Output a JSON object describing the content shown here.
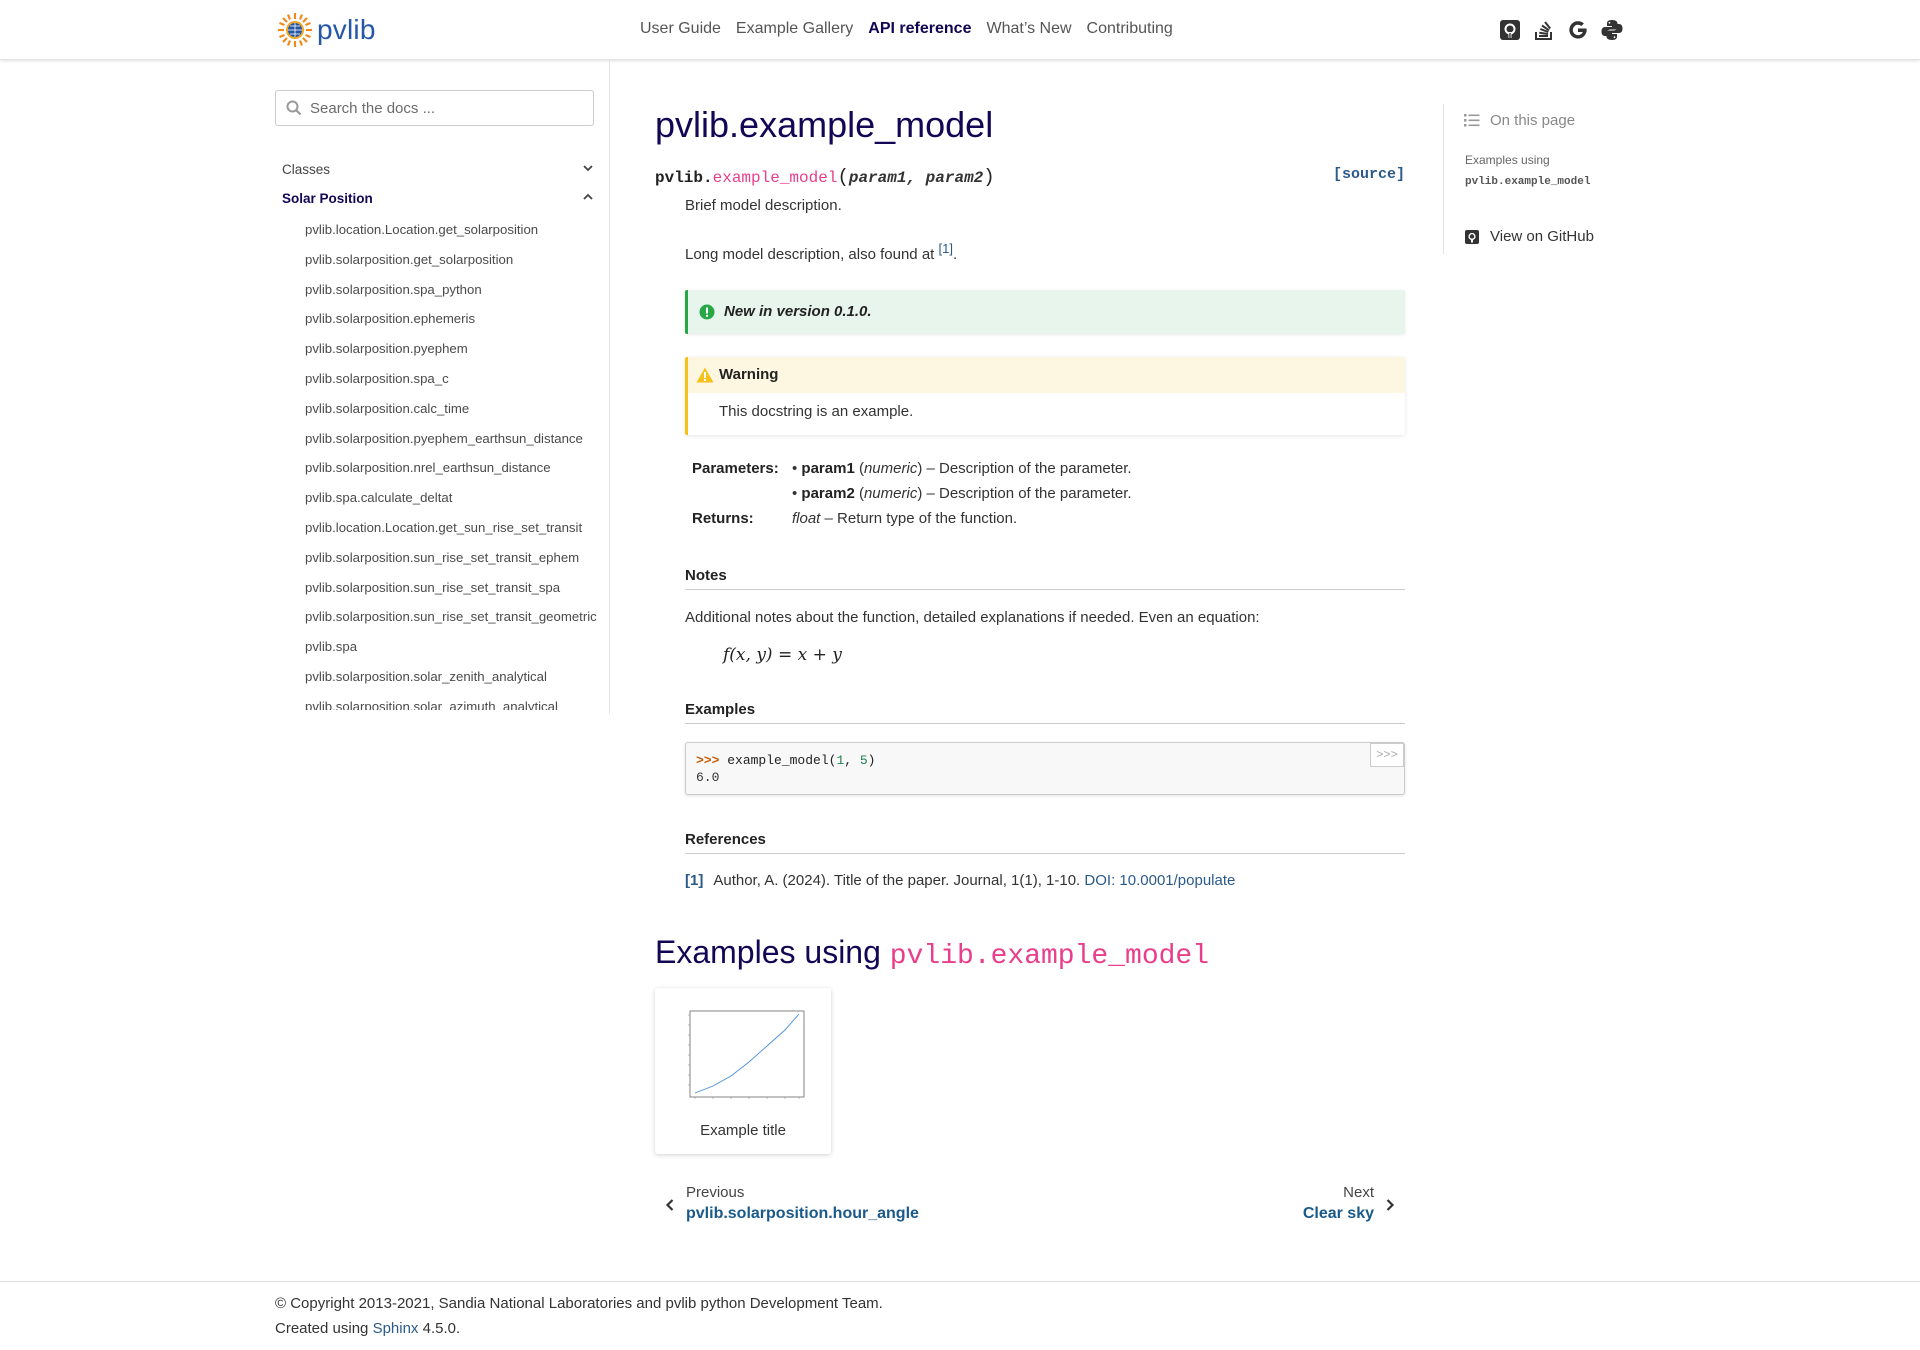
{
  "header": {
    "logo_text": "pvlib",
    "nav": [
      "User Guide",
      "Example Gallery",
      "API reference",
      "What’s New",
      "Contributing"
    ],
    "active_nav": "API reference",
    "icons": [
      "github-icon",
      "stackoverflow-icon",
      "google-icon",
      "python-icon"
    ]
  },
  "sidebar": {
    "search_placeholder": "Search the docs ...",
    "sections": [
      "Classes",
      "Solar Position"
    ],
    "items": [
      "pvlib.location.Location.get_solarposition",
      "pvlib.solarposition.get_solarposition",
      "pvlib.solarposition.spa_python",
      "pvlib.solarposition.ephemeris",
      "pvlib.solarposition.pyephem",
      "pvlib.solarposition.spa_c",
      "pvlib.solarposition.calc_time",
      "pvlib.solarposition.pyephem_earthsun_distance",
      "pvlib.solarposition.nrel_earthsun_distance",
      "pvlib.spa.calculate_deltat",
      "pvlib.location.Location.get_sun_rise_set_transit",
      "pvlib.solarposition.sun_rise_set_transit_ephem",
      "pvlib.solarposition.sun_rise_set_transit_spa",
      "pvlib.solarposition.sun_rise_set_transit_geometric",
      "pvlib.spa",
      "pvlib.solarposition.solar_zenith_analytical",
      "pvlib.solarposition.solar_azimuth_analytical"
    ]
  },
  "main": {
    "title": "pvlib.example_model",
    "signature": {
      "prefix": "pvlib.",
      "name": "example_model",
      "open": "(",
      "params": "param1, param2",
      "close": ")",
      "source": "[source]"
    },
    "brief": "Brief model description.",
    "long_desc": "Long model description, also found at ",
    "long_ref": "[1]",
    "long_end": ".",
    "new_version": "New in version 0.1.0.",
    "warning": {
      "title": "Warning",
      "body": "This docstring is an example."
    },
    "parameters_label": "Parameters:",
    "params": [
      {
        "name": "param1",
        "type": "numeric",
        "desc": " – Description of the parameter."
      },
      {
        "name": "param2",
        "type": "numeric",
        "desc": " – Description of the parameter."
      }
    ],
    "returns_label": "Returns:",
    "returns_type": "float",
    "returns_desc": " – Return type of the function.",
    "notes_title": "Notes",
    "notes_text": "Additional notes about the function, detailed explanations if needed. Even an equation:",
    "equation": "f(x, y) = x + y",
    "examples_title": "Examples",
    "code_prompt": ">>>",
    "code_call": "example_model(",
    "code_arg1": "1",
    "code_sep": ", ",
    "code_arg2": "5",
    "code_close": ")",
    "code_output": "6.0",
    "copy_label": ">>>",
    "references_title": "References",
    "ref_label": "[1]",
    "ref_text": "Author, A. (2024). Title of the paper. Journal, 1(1), 1-10. ",
    "ref_link": "DOI: 10.0001/populate",
    "examples_using_prefix": "Examples using ",
    "examples_using_code": "pvlib.example_model",
    "thumb_caption": "Example title",
    "prev_label": "Previous",
    "prev_title": "pvlib.solarposition.hour_angle",
    "next_label": "Next",
    "next_title": "Clear sky"
  },
  "toc": {
    "heading": "On this page",
    "item_line1": "Examples using",
    "item_line2": "pvlib.example_model",
    "github": "View on GitHub"
  },
  "footer": {
    "copyright": "© Copyright 2013-2021, Sandia National Laboratories and pvlib python Development Team.",
    "created_prefix": "Created using ",
    "sphinx": "Sphinx",
    "version": " 4.5.0."
  }
}
